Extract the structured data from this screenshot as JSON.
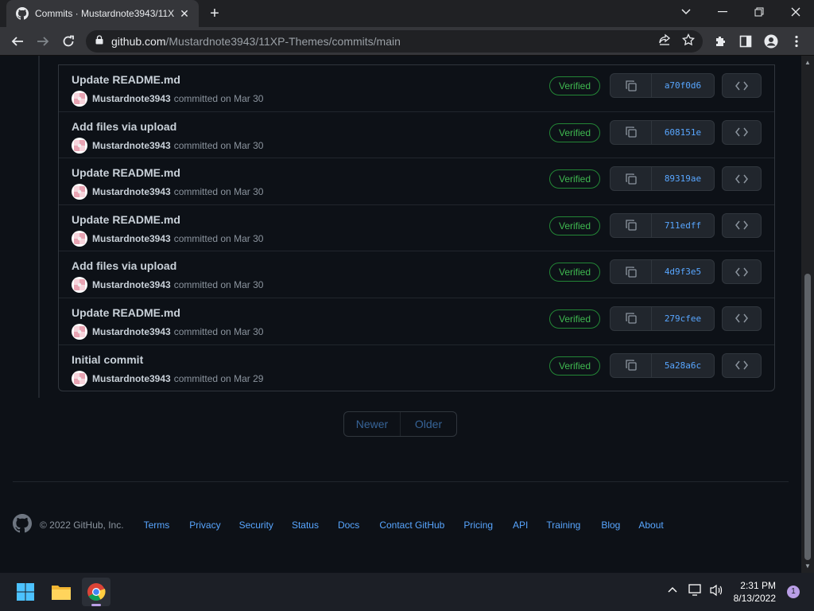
{
  "browser": {
    "tab_title": "Commits · Mustardnote3943/11X",
    "url_host": "github.com",
    "url_path": "/Mustardnote3943/11XP-Themes/commits/main"
  },
  "commits": [
    {
      "message": "Update README.md",
      "author": "Mustardnote3943",
      "date_text": "committed on Mar 30",
      "verified": "Verified",
      "sha": "a70f0d6"
    },
    {
      "message": "Add files via upload",
      "author": "Mustardnote3943",
      "date_text": "committed on Mar 30",
      "verified": "Verified",
      "sha": "608151e"
    },
    {
      "message": "Update README.md",
      "author": "Mustardnote3943",
      "date_text": "committed on Mar 30",
      "verified": "Verified",
      "sha": "89319ae"
    },
    {
      "message": "Update README.md",
      "author": "Mustardnote3943",
      "date_text": "committed on Mar 30",
      "verified": "Verified",
      "sha": "711edff"
    },
    {
      "message": "Add files via upload",
      "author": "Mustardnote3943",
      "date_text": "committed on Mar 30",
      "verified": "Verified",
      "sha": "4d9f3e5"
    },
    {
      "message": "Update README.md",
      "author": "Mustardnote3943",
      "date_text": "committed on Mar 30",
      "verified": "Verified",
      "sha": "279cfee"
    },
    {
      "message": "Initial commit",
      "author": "Mustardnote3943",
      "date_text": "committed on Mar 29",
      "verified": "Verified",
      "sha": "5a28a6c"
    }
  ],
  "pagination": {
    "newer": "Newer",
    "older": "Older"
  },
  "footer": {
    "copyright": "© 2022 GitHub, Inc.",
    "links": [
      "Terms",
      "Privacy",
      "Security",
      "Status",
      "Docs",
      "Contact GitHub",
      "Pricing",
      "API",
      "Training",
      "Blog",
      "About"
    ]
  },
  "taskbar": {
    "time": "2:31 PM",
    "date": "8/13/2022",
    "notifications": "1"
  },
  "colors": {
    "link": "#58a6ff",
    "verified": "#3fb950",
    "bg": "#0d1117"
  }
}
